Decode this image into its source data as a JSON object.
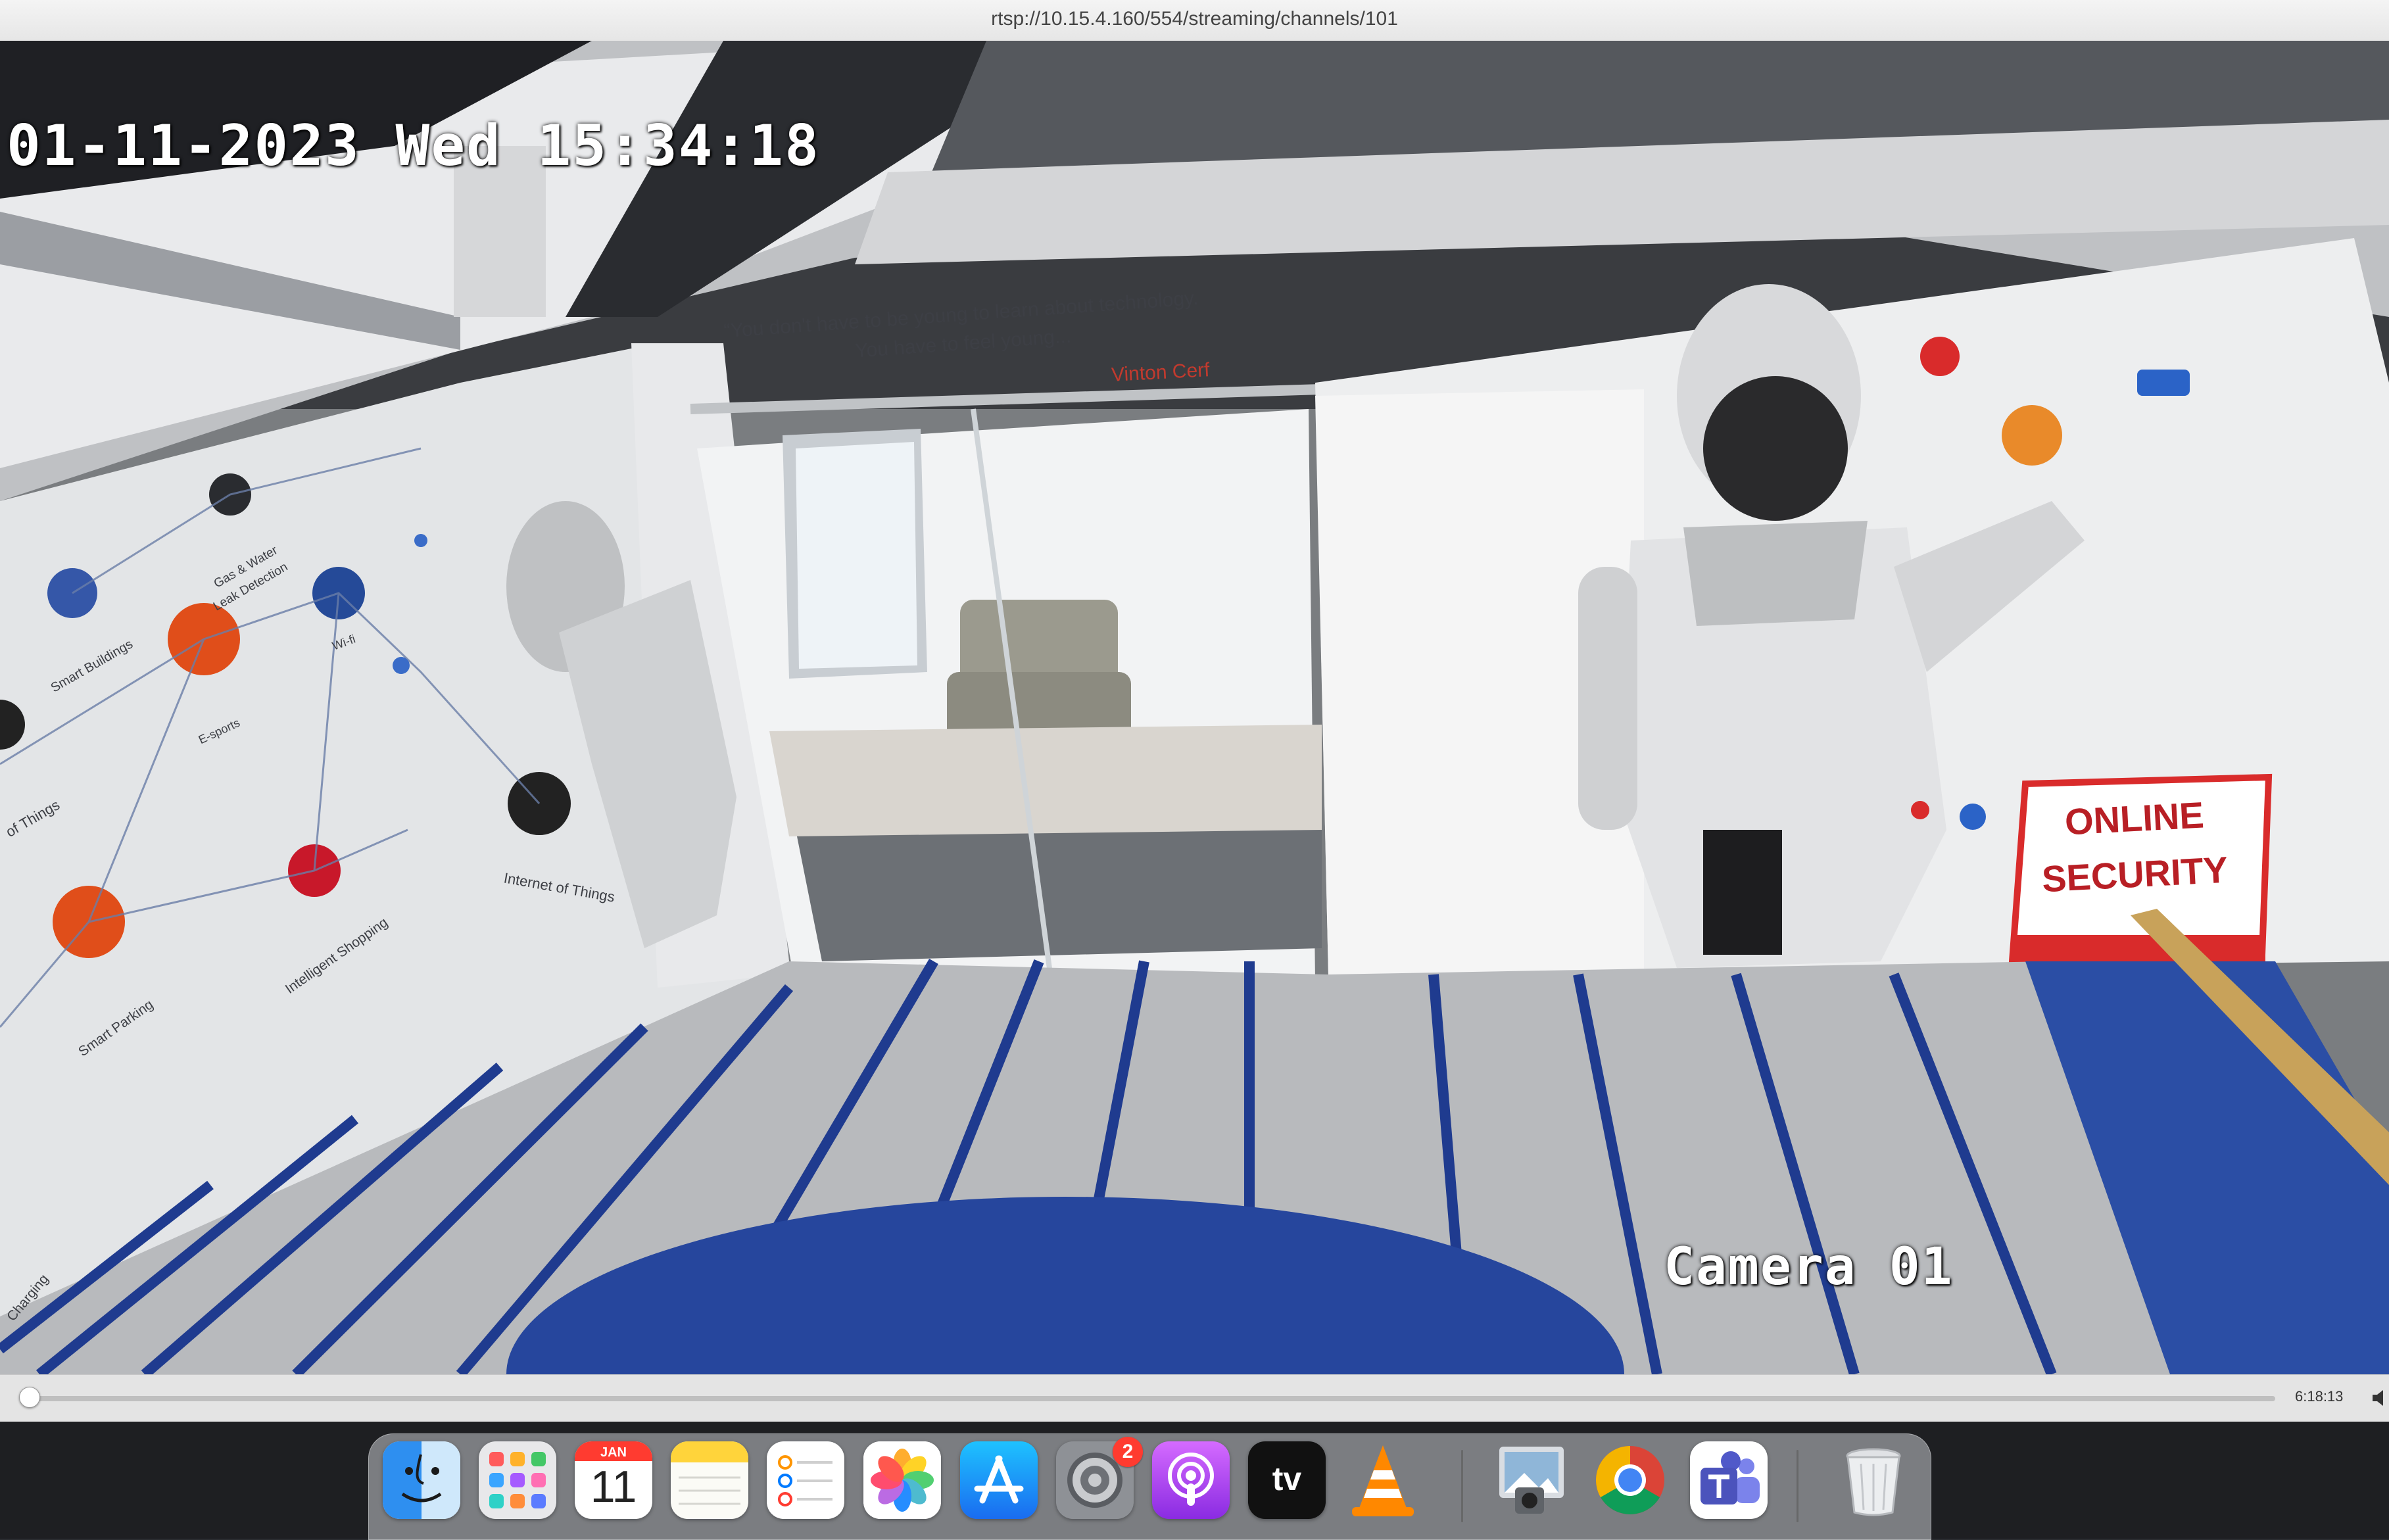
{
  "window": {
    "title": "rtsp://10.15.4.160/554/streaming/channels/101"
  },
  "video": {
    "timestamp_osd": "01-11-2023 Wed 15:34:18",
    "camera_label": "Camera 01",
    "wall_quote": {
      "line1": "“You don't have to be young to learn about technology.",
      "line2": "You have to feel young...",
      "author": "Vinton Cerf"
    },
    "wall_labels": {
      "gas_water": "Gas & Water",
      "leak_detection": "Leak Detection",
      "smart_buildings": "Smart Buildings",
      "wifi": "Wi-fi",
      "esports": "E-sports",
      "internet_of_things": "Internet of Things",
      "internet_of_things_left": "of Things",
      "intelligent_shopping": "Intelligent Shopping",
      "smart_parking": "Smart Parking",
      "charging": "Charging",
      "online": "ONLINE",
      "security": "SECURITY"
    }
  },
  "controls": {
    "duration": "6:18:13",
    "progress_fraction": 0.002
  },
  "dock": {
    "calendar": {
      "month": "JAN",
      "day": "11"
    },
    "settings_badge": "2",
    "tv_label": "tv",
    "items": [
      "finder",
      "launchpad",
      "calendar",
      "notes",
      "reminders",
      "photos",
      "app-store",
      "system-settings",
      "podcasts",
      "apple-tv",
      "vlc",
      "preview",
      "chrome",
      "teams",
      "trash"
    ]
  }
}
